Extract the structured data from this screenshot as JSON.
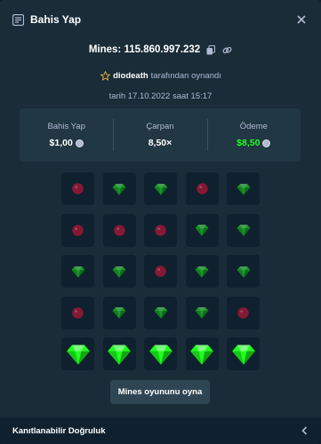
{
  "header": {
    "title": "Bahis Yap",
    "icon": "bet-slip-icon"
  },
  "game": {
    "label": "Mines: 115.860.997.232"
  },
  "player": {
    "name": "diodeath",
    "suffix": "tarafından oynandı"
  },
  "date": {
    "text": "tarih 17.10.2022 saat 15:17"
  },
  "stats": {
    "bet": {
      "label": "Bahis Yap",
      "value": "$1,00"
    },
    "multiplier": {
      "label": "Çarpan",
      "value": "8,50×"
    },
    "payout": {
      "label": "Ödeme",
      "value": "$8,50",
      "color": "#1fff20"
    }
  },
  "board": {
    "rows": [
      [
        "mine",
        "gem",
        "gem",
        "mine",
        "gem"
      ],
      [
        "mine",
        "mine",
        "mine",
        "gem",
        "gem"
      ],
      [
        "gem",
        "gem",
        "mine",
        "gem",
        "gem"
      ],
      [
        "mine",
        "gem",
        "gem",
        "gem",
        "mine"
      ],
      [
        "gem-found",
        "gem-found",
        "gem-found",
        "gem-found",
        "gem-found"
      ]
    ]
  },
  "play_button": {
    "label": "Mines oyununu oyna"
  },
  "footer": {
    "label": "Kanıtlanabilir Doğruluk"
  },
  "colors": {
    "background": "#1a2c38",
    "panel": "#213743",
    "tile": "#0f212e",
    "gem": "#1fff20",
    "mine": "#e9113c"
  }
}
